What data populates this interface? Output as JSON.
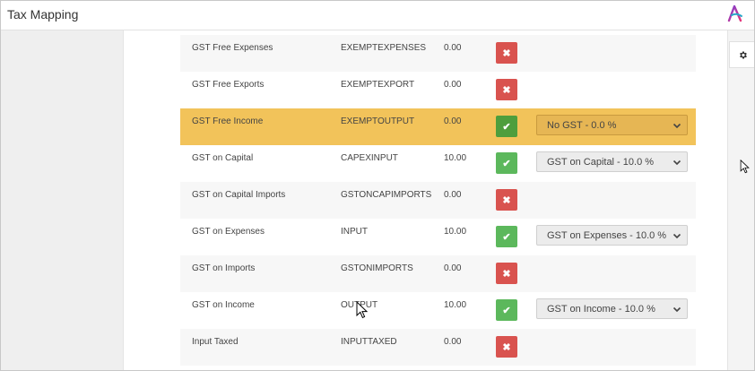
{
  "app": {
    "title": "Tax Mapping"
  },
  "icons": {
    "logo": "stylized-a-logo-icon",
    "gear": "gear-icon",
    "reject": "close-icon",
    "accept": "check-icon",
    "dropdown": "chevron-down-icon"
  },
  "colors": {
    "highlight_row": "#f2c35a",
    "reject": "#d9534f",
    "accept": "#5cb85c",
    "accept_selected": "#4e9e3d"
  },
  "rows": [
    {
      "name": "GST Free Expenses",
      "code": "EXEMPTEXPENSES",
      "rate": "0.00",
      "status_glyph": "✖",
      "status": "unmapped",
      "mapping": ""
    },
    {
      "name": "GST Free Exports",
      "code": "EXEMPTEXPORT",
      "rate": "0.00",
      "status_glyph": "✖",
      "status": "unmapped",
      "mapping": ""
    },
    {
      "name": "GST Free Income",
      "code": "EXEMPTOUTPUT",
      "rate": "0.00",
      "status_glyph": "✔",
      "status": "mapped",
      "mapping": "No GST - 0.0 %",
      "highlighted": true
    },
    {
      "name": "GST on Capital",
      "code": "CAPEXINPUT",
      "rate": "10.00",
      "status_glyph": "✔",
      "status": "mapped",
      "mapping": "GST on Capital - 10.0 %"
    },
    {
      "name": "GST on Capital Imports",
      "code": "GSTONCAPIMPORTS",
      "rate": "0.00",
      "status_glyph": "✖",
      "status": "unmapped",
      "mapping": ""
    },
    {
      "name": "GST on Expenses",
      "code": "INPUT",
      "rate": "10.00",
      "status_glyph": "✔",
      "status": "mapped",
      "mapping": "GST on Expenses - 10.0 %"
    },
    {
      "name": "GST on Imports",
      "code": "GSTONIMPORTS",
      "rate": "0.00",
      "status_glyph": "✖",
      "status": "unmapped",
      "mapping": ""
    },
    {
      "name": "GST on Income",
      "code": "OUTPUT",
      "rate": "10.00",
      "status_glyph": "✔",
      "status": "mapped",
      "mapping": "GST on Income - 10.0 %"
    },
    {
      "name": "Input Taxed",
      "code": "INPUTTAXED",
      "rate": "0.00",
      "status_glyph": "✖",
      "status": "unmapped",
      "mapping": ""
    }
  ]
}
